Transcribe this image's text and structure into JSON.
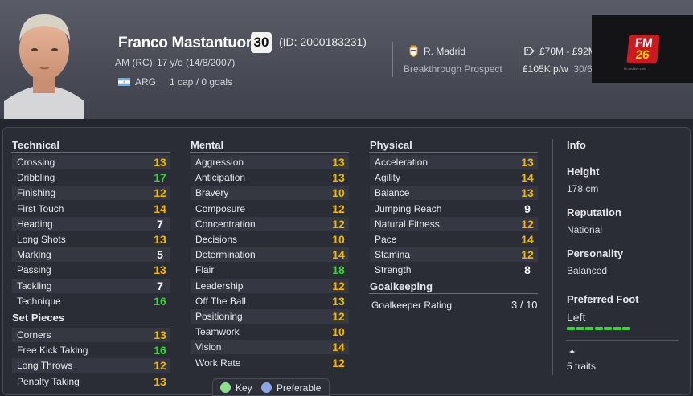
{
  "player": {
    "name": "Franco Mastantuono",
    "number": "30",
    "id": "(ID: 2000183231)",
    "position": "AM (RC)",
    "age": "17 y/o (14/8/2007)",
    "nation": "ARG",
    "caps": "1 cap / 0 goals",
    "club": "R. Madrid",
    "status": "Breakthrough Prospect",
    "value": "£70M - £92M",
    "wage": "£105K p/w",
    "contract": "30/6"
  },
  "logo": {
    "line1": "FM",
    "line2": "26",
    "sub": "fm-archive.com"
  },
  "technical": {
    "title": "Technical",
    "rows": [
      {
        "label": "Crossing",
        "value": "13",
        "color": "orange"
      },
      {
        "label": "Dribbling",
        "value": "17",
        "color": "green"
      },
      {
        "label": "Finishing",
        "value": "12",
        "color": "orange"
      },
      {
        "label": "First Touch",
        "value": "14",
        "color": "orange"
      },
      {
        "label": "Heading",
        "value": "7",
        "color": "white"
      },
      {
        "label": "Long Shots",
        "value": "13",
        "color": "orange"
      },
      {
        "label": "Marking",
        "value": "5",
        "color": "white"
      },
      {
        "label": "Passing",
        "value": "13",
        "color": "orange"
      },
      {
        "label": "Tackling",
        "value": "7",
        "color": "white"
      },
      {
        "label": "Technique",
        "value": "16",
        "color": "green"
      }
    ]
  },
  "set_pieces": {
    "title": "Set Pieces",
    "rows": [
      {
        "label": "Corners",
        "value": "13",
        "color": "orange"
      },
      {
        "label": "Free Kick Taking",
        "value": "16",
        "color": "green"
      },
      {
        "label": "Long Throws",
        "value": "12",
        "color": "orange"
      },
      {
        "label": "Penalty Taking",
        "value": "13",
        "color": "orange"
      }
    ]
  },
  "mental": {
    "title": "Mental",
    "rows": [
      {
        "label": "Aggression",
        "value": "13",
        "color": "orange"
      },
      {
        "label": "Anticipation",
        "value": "13",
        "color": "orange"
      },
      {
        "label": "Bravery",
        "value": "10",
        "color": "orange"
      },
      {
        "label": "Composure",
        "value": "12",
        "color": "orange"
      },
      {
        "label": "Concentration",
        "value": "12",
        "color": "orange"
      },
      {
        "label": "Decisions",
        "value": "10",
        "color": "orange"
      },
      {
        "label": "Determination",
        "value": "14",
        "color": "orange"
      },
      {
        "label": "Flair",
        "value": "18",
        "color": "green"
      },
      {
        "label": "Leadership",
        "value": "12",
        "color": "orange"
      },
      {
        "label": "Off The Ball",
        "value": "13",
        "color": "orange"
      },
      {
        "label": "Positioning",
        "value": "12",
        "color": "orange"
      },
      {
        "label": "Teamwork",
        "value": "10",
        "color": "orange"
      },
      {
        "label": "Vision",
        "value": "14",
        "color": "orange"
      },
      {
        "label": "Work Rate",
        "value": "12",
        "color": "orange"
      }
    ]
  },
  "physical": {
    "title": "Physical",
    "rows": [
      {
        "label": "Acceleration",
        "value": "13",
        "color": "orange"
      },
      {
        "label": "Agility",
        "value": "14",
        "color": "orange"
      },
      {
        "label": "Balance",
        "value": "13",
        "color": "orange"
      },
      {
        "label": "Jumping Reach",
        "value": "9",
        "color": "white"
      },
      {
        "label": "Natural Fitness",
        "value": "12",
        "color": "orange"
      },
      {
        "label": "Pace",
        "value": "14",
        "color": "orange"
      },
      {
        "label": "Stamina",
        "value": "12",
        "color": "orange"
      },
      {
        "label": "Strength",
        "value": "8",
        "color": "white"
      }
    ]
  },
  "goalkeeping": {
    "title": "Goalkeeping",
    "rating_label": "Goalkeeper Rating",
    "rating_value": "3 / 10"
  },
  "info": {
    "title": "Info",
    "height_label": "Height",
    "height_value": "178 cm",
    "reputation_label": "Reputation",
    "reputation_value": "National",
    "personality_label": "Personality",
    "personality_value": "Balanced",
    "foot_label": "Preferred Foot",
    "foot_value": "Left",
    "foot_level": 1.0,
    "traits": "5 traits"
  },
  "legend": {
    "key": "Key",
    "preferable": "Preferable"
  },
  "colors": {
    "orange": "#f2b705",
    "green": "#3bd23b",
    "white": "#f4f4f4",
    "key_dot": "#8ee08e",
    "pref_dot": "#8aa6e6"
  }
}
